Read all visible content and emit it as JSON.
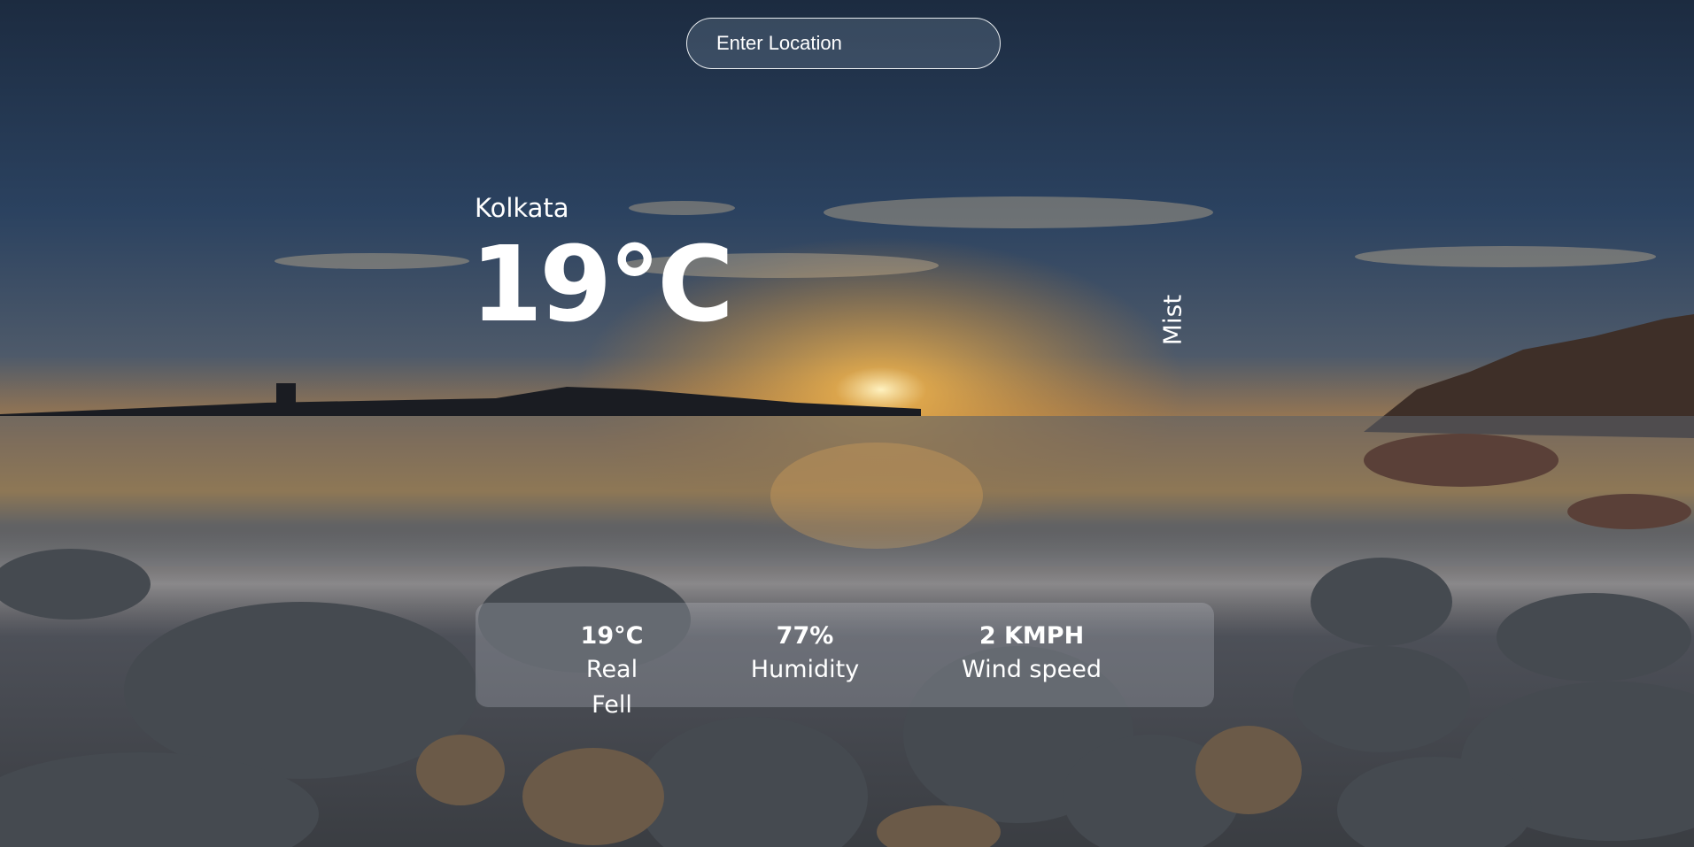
{
  "search": {
    "placeholder": "Enter Location"
  },
  "weather": {
    "city": "Kolkata",
    "temperature": "19°C",
    "condition": "Mist"
  },
  "details": [
    {
      "value": "19°C",
      "label": "Real Fell"
    },
    {
      "value": "77%",
      "label": "Humidity"
    },
    {
      "value": "2 KMPH",
      "label": "Wind speed"
    }
  ],
  "colors": {
    "sky_top": "#1e3048",
    "sunset": "#d98a2a",
    "sea": "#5a5f66",
    "rocks": "#3a3f45"
  }
}
